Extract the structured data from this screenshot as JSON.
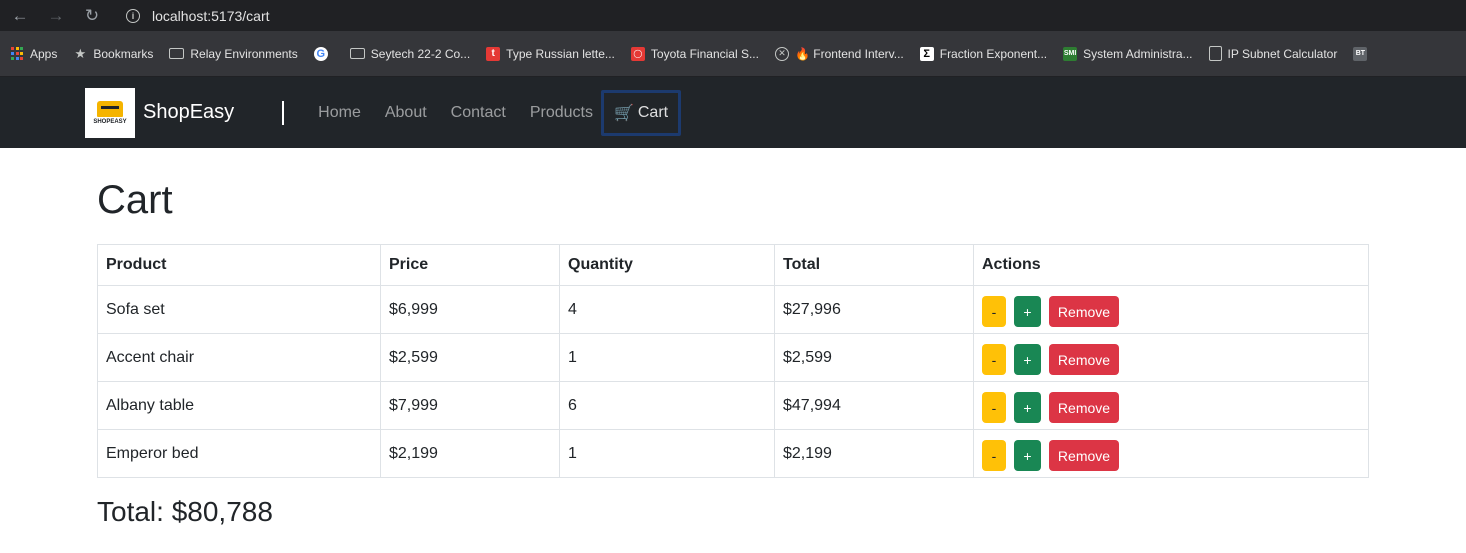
{
  "browser": {
    "url": "localhost:5173/cart",
    "bookmarks": [
      {
        "label": "Apps",
        "icon": "apps-icon"
      },
      {
        "label": "Bookmarks",
        "icon": "star-icon"
      },
      {
        "label": "Relay Environments",
        "icon": "folder-icon"
      },
      {
        "label": "",
        "icon": "google-icon"
      },
      {
        "label": "Seytech 22-2 Co...",
        "icon": "folder-icon"
      },
      {
        "label": "Type Russian lette...",
        "icon": "t-icon"
      },
      {
        "label": "Toyota Financial S...",
        "icon": "toyota-icon"
      },
      {
        "label": "🔥 Frontend Interv...",
        "icon": "x-circle-icon"
      },
      {
        "label": "Fraction Exponent...",
        "icon": "sigma-icon"
      },
      {
        "label": "System Administra...",
        "icon": "smi-icon"
      },
      {
        "label": "IP Subnet Calculator",
        "icon": "calculator-icon"
      },
      {
        "label": "",
        "icon": "bt-icon"
      }
    ]
  },
  "navbar": {
    "logo_text": "SHOPEASY",
    "brand": "ShopEasy",
    "links": [
      "Home",
      "About",
      "Contact",
      "Products"
    ],
    "cart_label": "Cart"
  },
  "page": {
    "title": "Cart",
    "columns": [
      "Product",
      "Price",
      "Quantity",
      "Total",
      "Actions"
    ],
    "rows": [
      {
        "product": "Sofa set",
        "price": "$6,999",
        "quantity": "4",
        "total": "$27,996"
      },
      {
        "product": "Accent chair",
        "price": "$2,599",
        "quantity": "1",
        "total": "$2,599"
      },
      {
        "product": "Albany table",
        "price": "$7,999",
        "quantity": "6",
        "total": "$47,994"
      },
      {
        "product": "Emperor bed",
        "price": "$2,199",
        "quantity": "1",
        "total": "$2,199"
      }
    ],
    "actions": {
      "decrease": "-",
      "increase": "+",
      "remove": "Remove"
    },
    "total_label": "Total: $80,788"
  },
  "colors": {
    "navbar_bg": "#212529",
    "decrease": "#ffc107",
    "increase": "#198754",
    "remove": "#dc3545",
    "active_outline": "#1c3a6e"
  }
}
